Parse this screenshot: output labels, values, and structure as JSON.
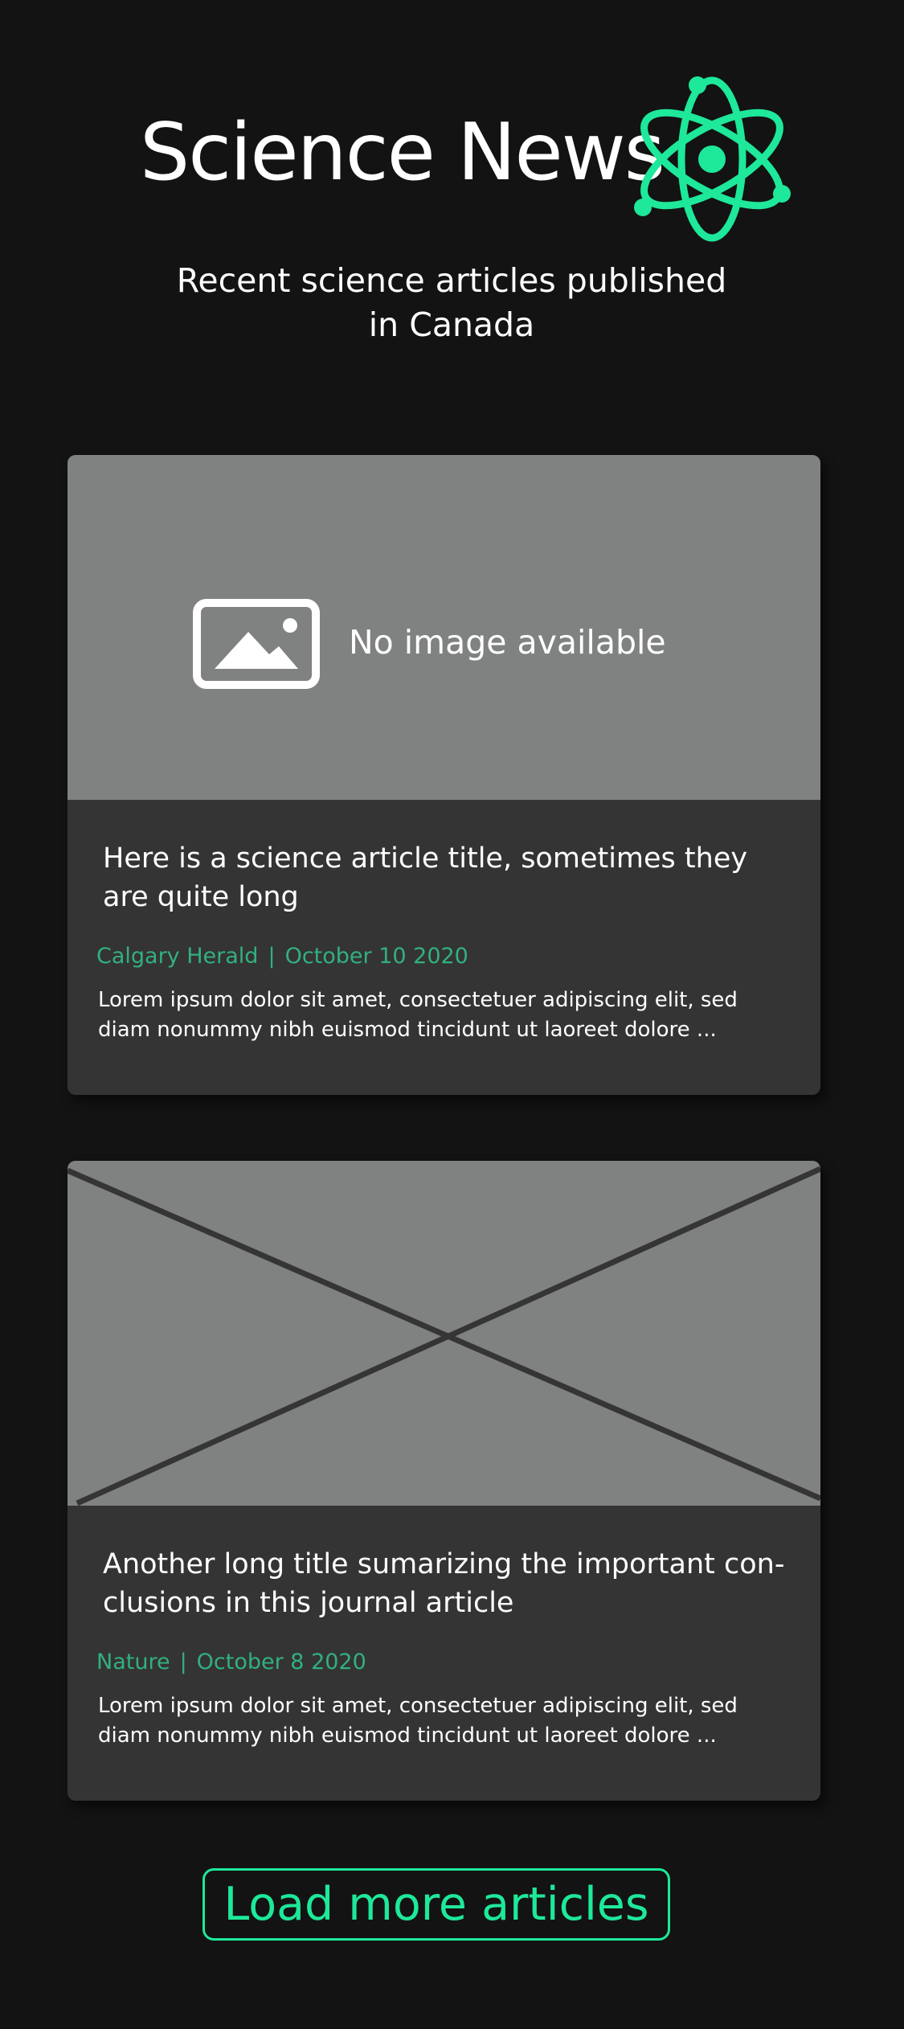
{
  "header": {
    "title": "Science News",
    "logo_icon": "atom-icon",
    "subtitle": "Recent science articles published in Canada"
  },
  "articles": [
    {
      "media": {
        "type": "no-image",
        "icon": "image-placeholder-icon",
        "text": "No image available"
      },
      "title": "Here is a science article title, sometimes they are quite long",
      "source": "Calgary Herald",
      "separator": "|",
      "date": "October 10 2020",
      "excerpt": "Lorem ipsum dolor sit amet, consectetuer adipiscing elit, sed diam nonummy nibh euismod tincidunt ut laoreet dolore ..."
    },
    {
      "media": {
        "type": "placeholder-cross"
      },
      "title": "Another long title sumarizing the important con-clusions in this journal article",
      "source": "Nature",
      "separator": "|",
      "date": "October 8 2020",
      "excerpt": "Lorem ipsum dolor sit amet, consectetuer adipiscing elit, sed diam nonummy nibh euismod tincidunt ut laoreet dolore ..."
    }
  ],
  "actions": {
    "load_more_label": "Load more articles"
  },
  "colors": {
    "background": "#131313",
    "card": "#343434",
    "media_placeholder": "#7f8280",
    "accent": "#1ee89a",
    "meta_text": "#32b07f",
    "text": "#ffffff"
  }
}
